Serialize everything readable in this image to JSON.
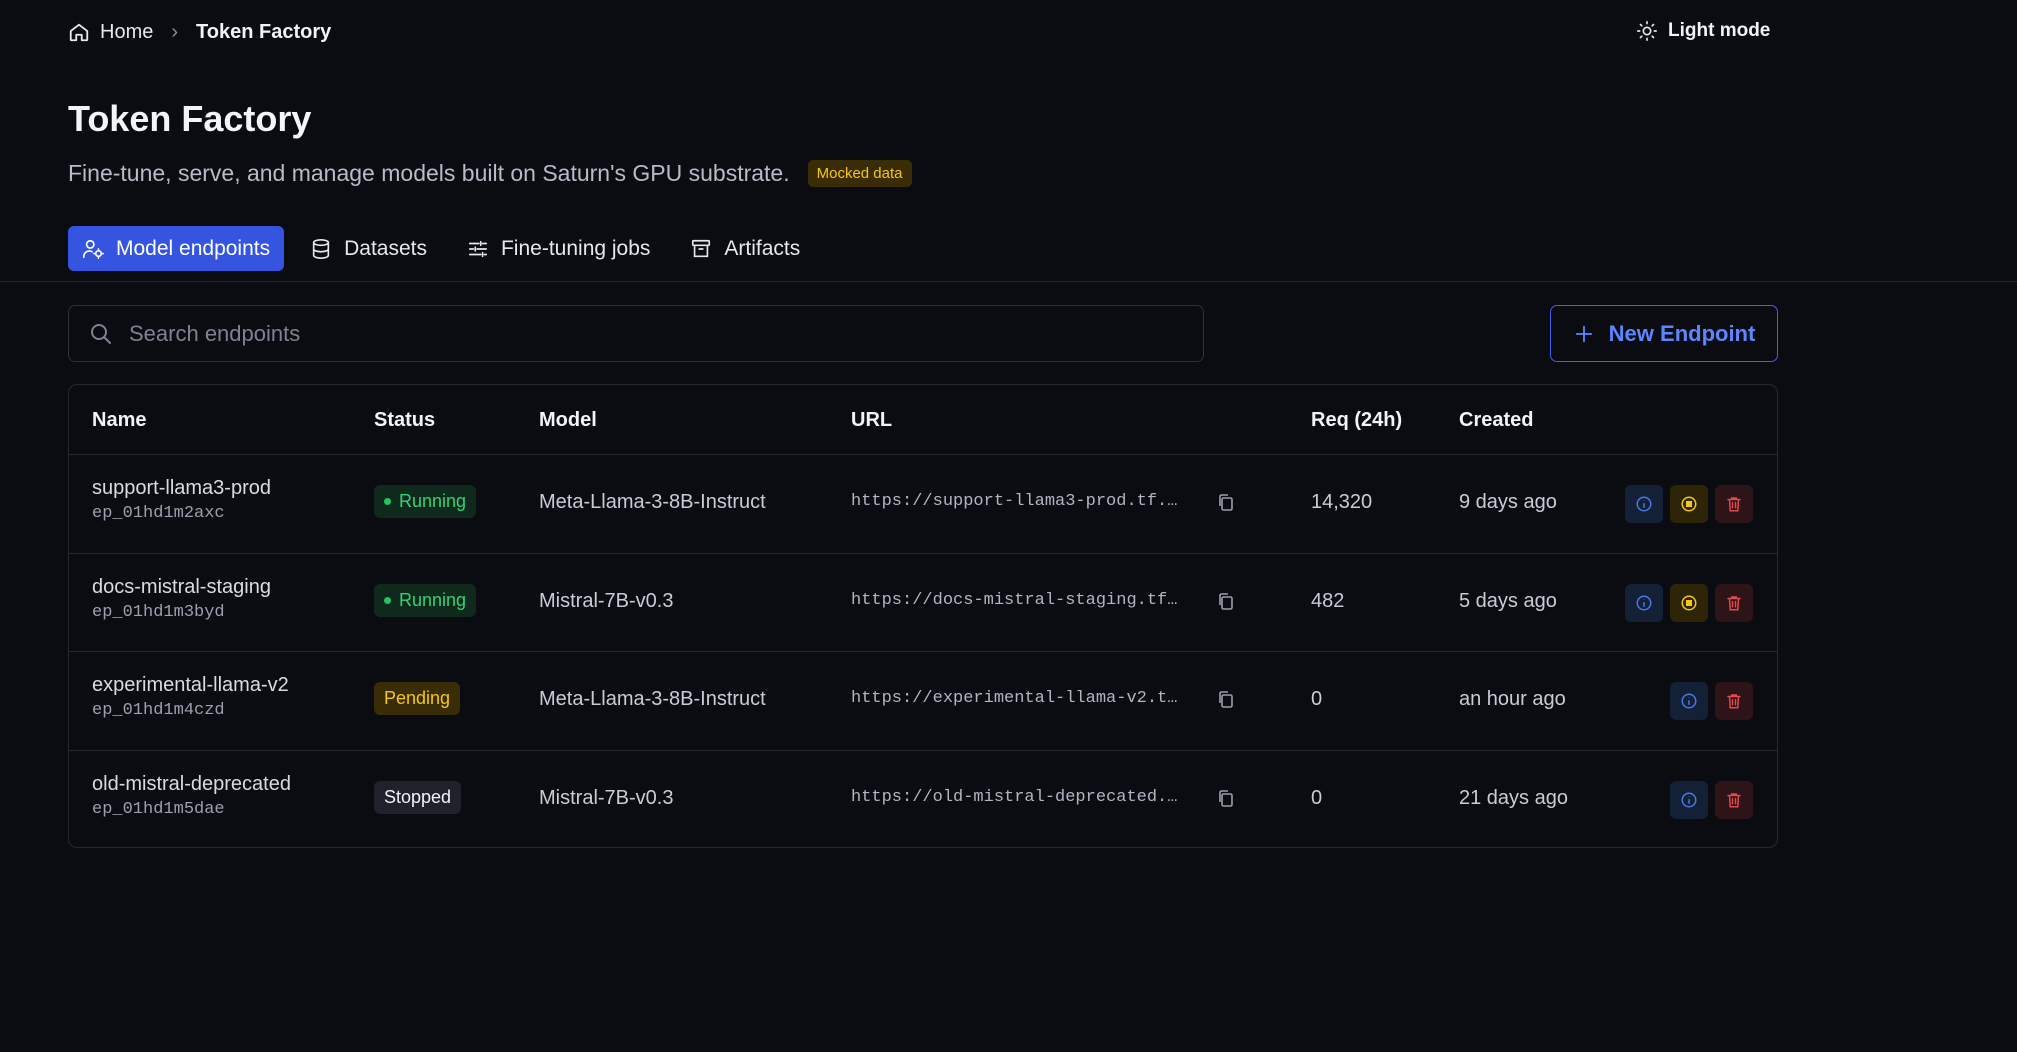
{
  "breadcrumb": {
    "home": "Home",
    "separator": "›",
    "current": "Token Factory"
  },
  "theme_toggle": {
    "label": "Light mode",
    "icon": "sun-icon"
  },
  "header": {
    "title": "Token Factory",
    "subtitle": "Fine-tune, serve, and manage models built on Saturn's GPU substrate.",
    "badge": "Mocked data"
  },
  "tabs": [
    {
      "label": "Model endpoints",
      "icon": "endpoint-icon",
      "active": true
    },
    {
      "label": "Datasets",
      "icon": "database-icon",
      "active": false
    },
    {
      "label": "Fine-tuning jobs",
      "icon": "sliders-icon",
      "active": false
    },
    {
      "label": "Artifacts",
      "icon": "archive-icon",
      "active": false
    }
  ],
  "search": {
    "placeholder": "Search endpoints",
    "value": ""
  },
  "new_endpoint": {
    "label": "New Endpoint"
  },
  "table": {
    "columns": [
      "Name",
      "Status",
      "Model",
      "URL",
      "Req (24h)",
      "Created"
    ],
    "rows": [
      {
        "name": "support-llama3-prod",
        "id": "ep_01hd1m2axc",
        "status": "Running",
        "model": "Meta-Llama-3-8B-Instruct",
        "url": "https://support-llama3-prod.tf.…",
        "requests": "14,320",
        "created": "9 days ago"
      },
      {
        "name": "docs-mistral-staging",
        "id": "ep_01hd1m3byd",
        "status": "Running",
        "model": "Mistral-7B-v0.3",
        "url": "https://docs-mistral-staging.tf…",
        "requests": "482",
        "created": "5 days ago"
      },
      {
        "name": "experimental-llama-v2",
        "id": "ep_01hd1m4czd",
        "status": "Pending",
        "model": "Meta-Llama-3-8B-Instruct",
        "url": "https://experimental-llama-v2.t…",
        "requests": "0",
        "created": "an hour ago"
      },
      {
        "name": "old-mistral-deprecated",
        "id": "ep_01hd1m5dae",
        "status": "Stopped",
        "model": "Mistral-7B-v0.3",
        "url": "https://old-mistral-deprecated.…",
        "requests": "0",
        "created": "21 days ago"
      }
    ]
  },
  "colors": {
    "accent": "#3555e0",
    "running": "#34d373",
    "pending": "#f5c518",
    "danger": "#e5484d",
    "background": "#0b0b12"
  }
}
